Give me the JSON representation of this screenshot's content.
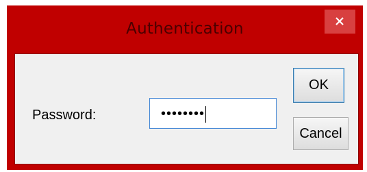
{
  "window": {
    "title": "Authentication",
    "frame_color": "#c00000",
    "close_icon": "close-icon"
  },
  "form": {
    "password_label": "Password:",
    "password_mask": "••••••••"
  },
  "buttons": {
    "ok_label": "OK",
    "cancel_label": "Cancel"
  }
}
